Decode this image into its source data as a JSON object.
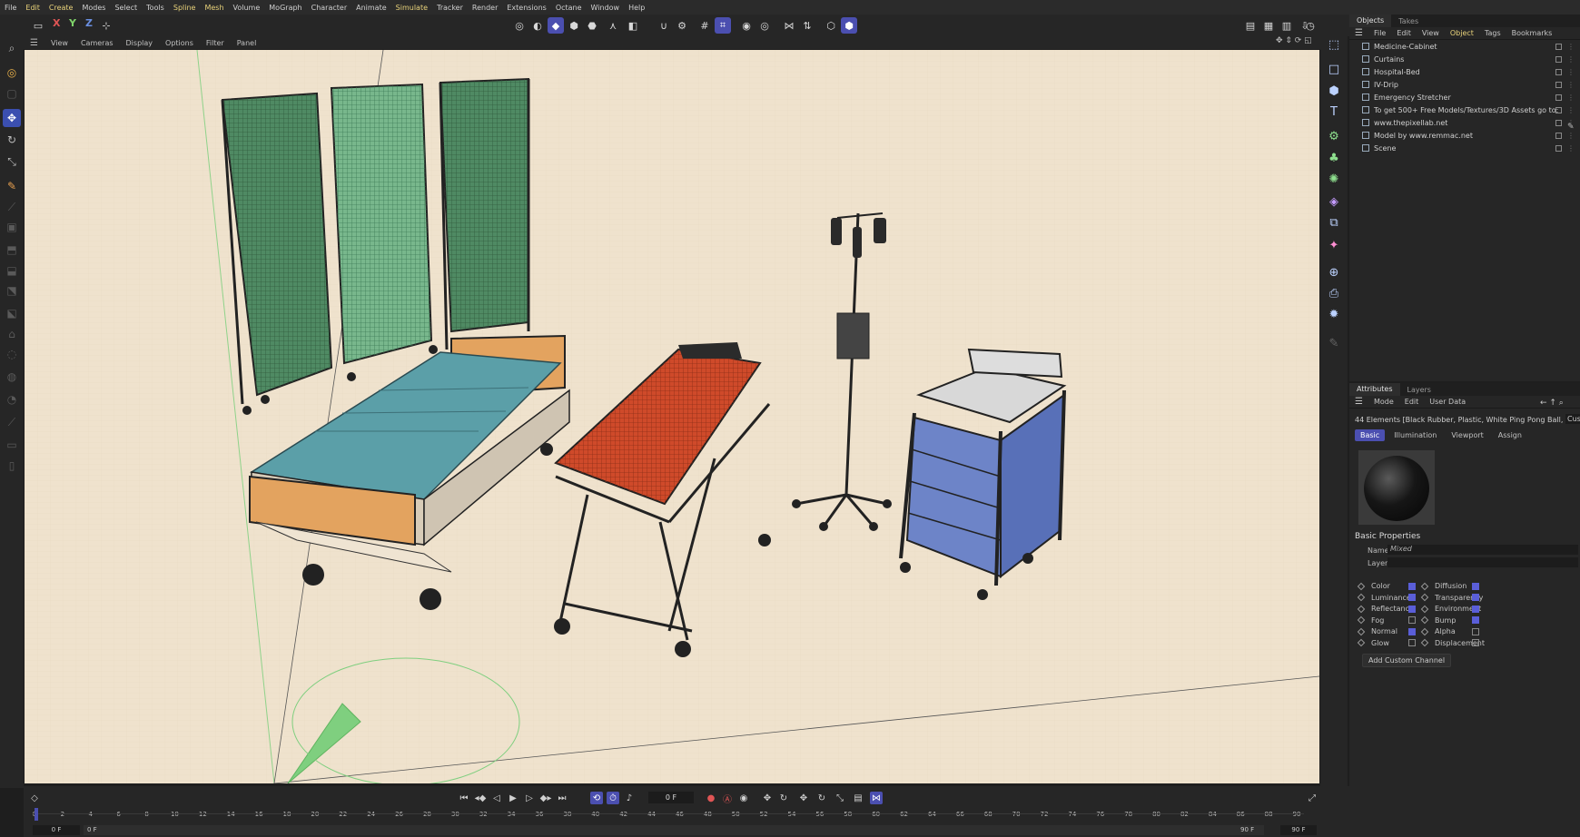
{
  "menubar": {
    "items": [
      {
        "label": "File",
        "hl": false
      },
      {
        "label": "Edit",
        "hl": true
      },
      {
        "label": "Create",
        "hl": true
      },
      {
        "label": "Modes",
        "hl": false
      },
      {
        "label": "Select",
        "hl": false
      },
      {
        "label": "Tools",
        "hl": false
      },
      {
        "label": "Spline",
        "hl": true
      },
      {
        "label": "Mesh",
        "hl": true
      },
      {
        "label": "Volume",
        "hl": false
      },
      {
        "label": "MoGraph",
        "hl": false
      },
      {
        "label": "Character",
        "hl": false
      },
      {
        "label": "Animate",
        "hl": false
      },
      {
        "label": "Simulate",
        "hl": true
      },
      {
        "label": "Tracker",
        "hl": false
      },
      {
        "label": "Render",
        "hl": false
      },
      {
        "label": "Extensions",
        "hl": false
      },
      {
        "label": "Octane",
        "hl": false
      },
      {
        "label": "Window",
        "hl": false
      },
      {
        "label": "Help",
        "hl": false
      }
    ]
  },
  "toolbar": {
    "axis_x": "X",
    "axis_y": "Y",
    "axis_z": "Z"
  },
  "viewport_menu": {
    "items": [
      "View",
      "Cameras",
      "Display",
      "Options",
      "Filter",
      "Panel"
    ]
  },
  "objects_panel": {
    "tabs": [
      "Objects",
      "Takes"
    ],
    "menu": [
      "File",
      "Edit",
      "View",
      "Object",
      "Tags",
      "Bookmarks"
    ],
    "rows": [
      "Medicine-Cabinet",
      "Curtains",
      "Hospital-Bed",
      "IV-Drip",
      "Emergency Stretcher",
      "To get 500+ Free Models/Textures/3D Assets go to:",
      "www.thepixellab.net",
      "Model by www.remmac.net",
      "Scene"
    ]
  },
  "attributes_panel": {
    "tabs": [
      "Attributes",
      "Layers"
    ],
    "menu": [
      "Mode",
      "Edit",
      "User Data"
    ],
    "selection": "44 Elements [Black Rubber, Plastic, White Ping Pong Ball, Plas...",
    "cut_label": "Cus",
    "subtabs": [
      "Basic",
      "Illumination",
      "Viewport",
      "Assign"
    ],
    "section": "Basic Properties",
    "name_label": "Name",
    "name_value": "Mixed",
    "layer_label": "Layer",
    "channels_left": [
      {
        "label": "Color",
        "on": true
      },
      {
        "label": "Luminance",
        "on": true
      },
      {
        "label": "Reflectance",
        "on": true
      },
      {
        "label": "Fog",
        "on": false
      },
      {
        "label": "Normal",
        "on": true
      },
      {
        "label": "Glow",
        "on": false
      }
    ],
    "channels_right": [
      {
        "label": "Diffusion",
        "on": true
      },
      {
        "label": "Transparency",
        "on": true
      },
      {
        "label": "Environment",
        "on": true
      },
      {
        "label": "Bump",
        "on": true
      },
      {
        "label": "Alpha",
        "on": false
      },
      {
        "label": "Displacement",
        "on": false
      }
    ],
    "add_channel": "Add Custom Channel"
  },
  "timeline": {
    "current_frame": "0 F",
    "start_field": "0 F",
    "start_field2": "0 F",
    "end_field": "90 F",
    "end_field2": "90 F",
    "ruler": [
      "0",
      "2",
      "4",
      "6",
      "8",
      "10",
      "12",
      "14",
      "16",
      "18",
      "20",
      "22",
      "24",
      "26",
      "28",
      "30",
      "32",
      "34",
      "36",
      "38",
      "40",
      "42",
      "44",
      "46",
      "48",
      "50",
      "52",
      "54",
      "56",
      "58",
      "60",
      "62",
      "64",
      "66",
      "68",
      "70",
      "72",
      "74",
      "76",
      "78",
      "80",
      "82",
      "84",
      "86",
      "88",
      "90"
    ]
  },
  "colors": {
    "accent": "#4b4fb0",
    "viewport_bg": "#efe2cd",
    "curtain": "#4f8a63",
    "mattress": "#5b9fa8",
    "stretcher_pad": "#cf4a2a",
    "cabinet_drawers": "#6d84c8",
    "bed_wood": "#e3a35f"
  }
}
